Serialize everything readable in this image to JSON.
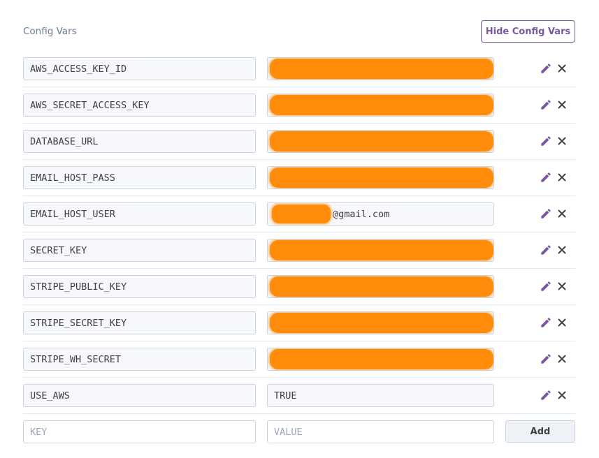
{
  "header": {
    "title": "Config Vars",
    "hide_label": "Hide Config Vars"
  },
  "accent_color": "#79589f",
  "redaction_color": "#ff8c0a",
  "vars": [
    {
      "key": "AWS_ACCESS_KEY_ID",
      "value": ""
    },
    {
      "key": "AWS_SECRET_ACCESS_KEY",
      "value": ""
    },
    {
      "key": "DATABASE_URL",
      "value": ""
    },
    {
      "key": "EMAIL_HOST_PASS",
      "value": ""
    },
    {
      "key": "EMAIL_HOST_USER",
      "value": "@gmail.com"
    },
    {
      "key": "SECRET_KEY",
      "value": ""
    },
    {
      "key": "STRIPE_PUBLIC_KEY",
      "value": ""
    },
    {
      "key": "STRIPE_SECRET_KEY",
      "value": ""
    },
    {
      "key": "STRIPE_WH_SECRET",
      "value": ""
    },
    {
      "key": "USE_AWS",
      "value": "TRUE"
    }
  ],
  "new_var": {
    "key_placeholder": "KEY",
    "value_placeholder": "VALUE",
    "add_label": "Add"
  },
  "icons": {
    "edit": "pencil-icon",
    "delete": "close-icon"
  }
}
